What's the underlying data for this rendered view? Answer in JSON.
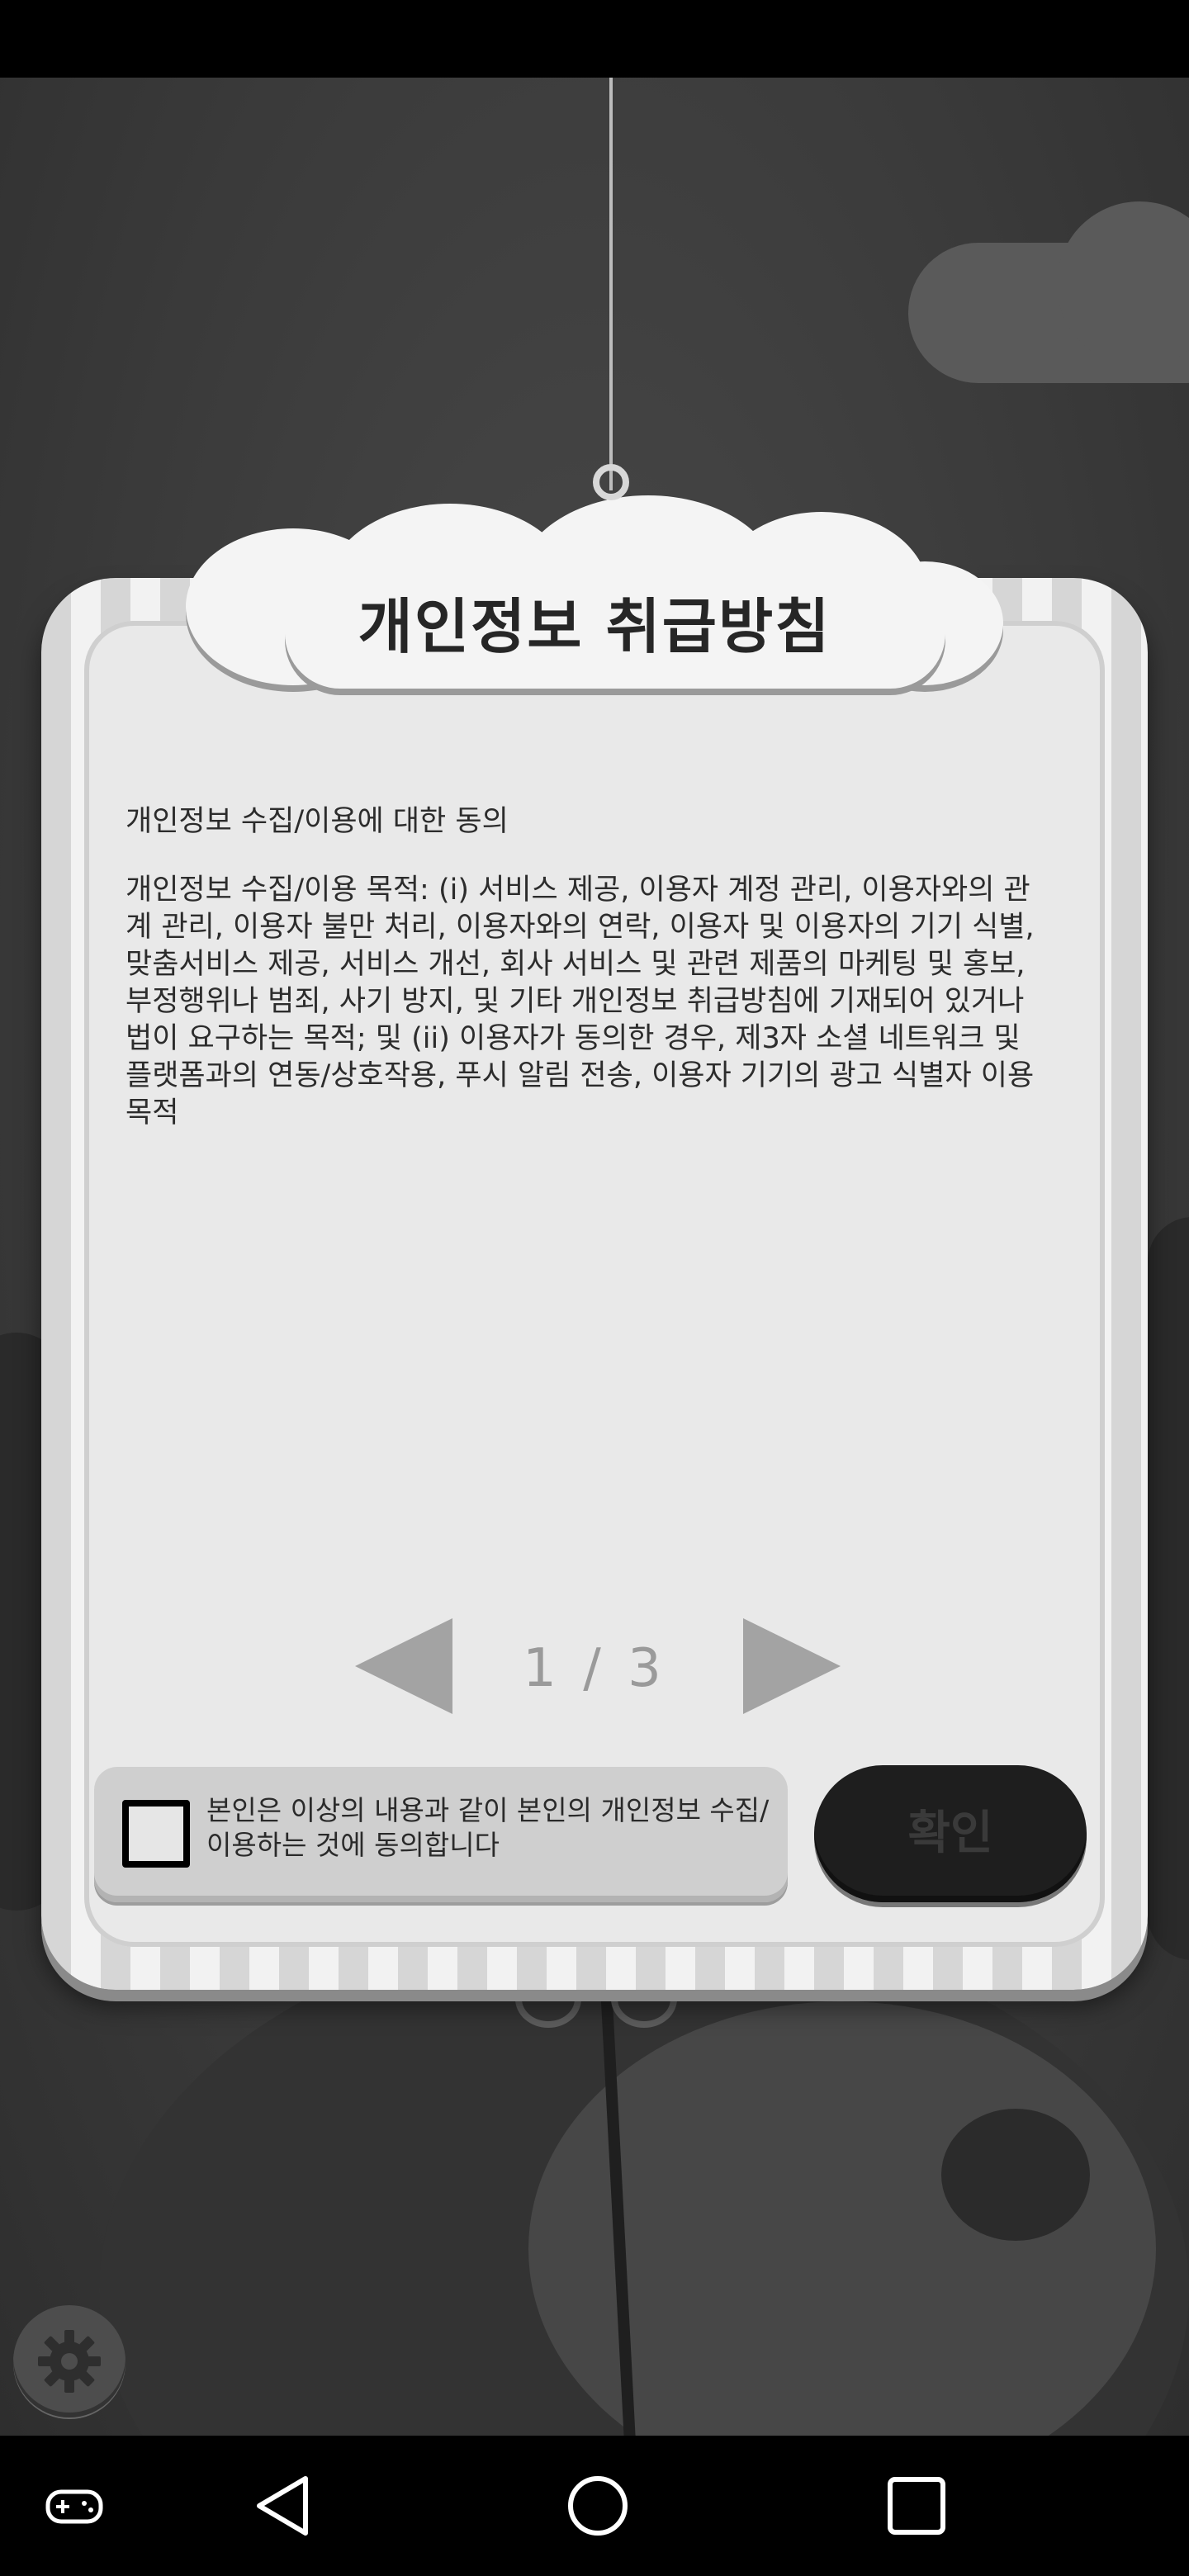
{
  "dialog": {
    "title": "개인정보 취급방침",
    "heading": "개인정보 수집/이용에 대한 동의",
    "body": "개인정보 수집/이용 목적: (i) 서비스 제공, 이용자 계정 관리, 이용자와의 관계 관리, 이용자 불만 처리, 이용자와의 연락, 이용자 및 이용자의 기기 식별, 맞춤서비스 제공, 서비스 개선, 회사 서비스 및 관련 제품의 마케팅 및 홍보, 부정행위나 범죄, 사기 방지, 및 기타 개인정보 취급방침에 기재되어 있거나 법이 요구하는 목적; 및 (ii) 이용자가 동의한 경우, 제3자 소셜 네트워크 및 플랫폼과의 연동/상호작용, 푸시 알림 전송, 이용자 기기의 광고 식별자 이용 목적",
    "pager": {
      "label": "1 / 3",
      "prev_icon": "left-triangle-icon",
      "next_icon": "right-triangle-icon"
    },
    "agreement": {
      "text": "본인은 이상의 내용과 같이 본인의 개인정보 수집/이용하는 것에 동의합니다",
      "checked": false
    },
    "confirm_label": "확인"
  },
  "settings": {
    "icon": "gear-icon"
  },
  "nav_bar": {
    "items": [
      "gamepad-icon",
      "back-icon",
      "home-icon",
      "recents-icon"
    ]
  },
  "colors": {
    "background": "#3e3e3e",
    "dialog_frame": "#e9e9e9",
    "confirm_button": "#1e1e1e",
    "pager_arrow": "#a3a3a3"
  }
}
